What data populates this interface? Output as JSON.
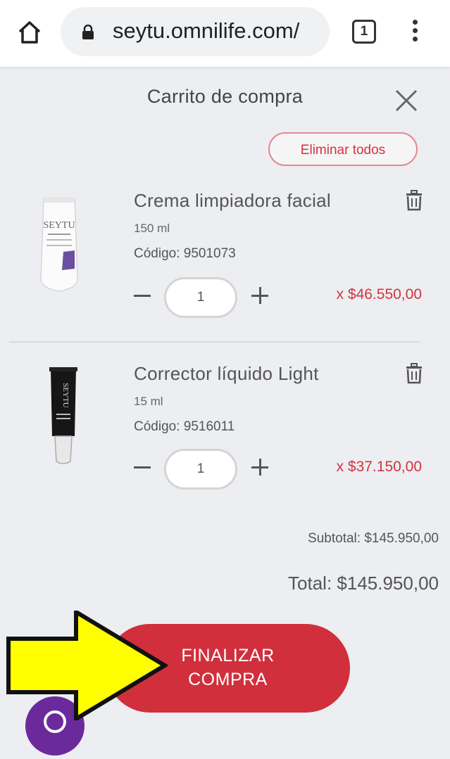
{
  "browser": {
    "url": "seytu.omnilife.com/",
    "tab_count": "1"
  },
  "cart": {
    "title": "Carrito de compra",
    "clear_all_label": "Eliminar todos",
    "items": [
      {
        "name": "Crema limpiadora facial",
        "size": "150 ml",
        "code": "Código: 9501073",
        "quantity": "1",
        "price": "x $46.550,00",
        "image_text": "SEYTU"
      },
      {
        "name": "Corrector líquido Light",
        "size": "15 ml",
        "code": "Código: 9516011",
        "quantity": "1",
        "price": "x $37.150,00",
        "image_text": "SEYTU"
      }
    ],
    "subtotal": "Subtotal: $145.950,00",
    "total": "Total: $145.950,00",
    "checkout_label_line1": "FINALIZAR",
    "checkout_label_line2": "COMPRA"
  },
  "colors": {
    "accent_red": "#d12f3c",
    "annotation_yellow": "#ffff00",
    "help_purple": "#6b2a9b"
  },
  "icons": [
    "home-icon",
    "lock-icon",
    "tabs-icon",
    "more-vert-icon",
    "close-icon",
    "trash-icon",
    "minus-icon",
    "plus-icon",
    "arrow-right-annotation"
  ]
}
